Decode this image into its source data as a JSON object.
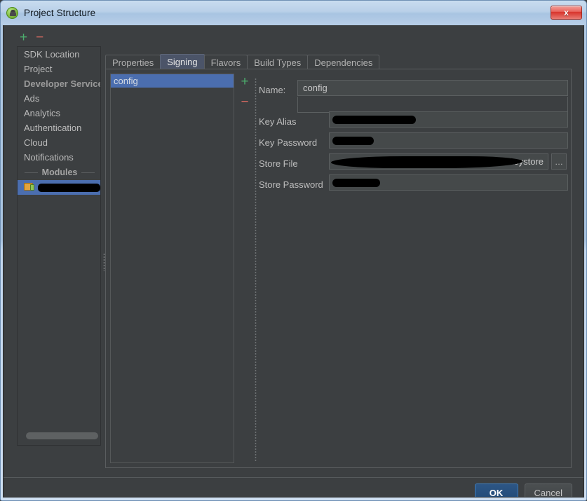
{
  "window": {
    "title": "Project Structure",
    "app_icon": "android-studio-icon",
    "close_label": "x"
  },
  "sidebar": {
    "toolbar": {
      "add_label": "+",
      "remove_label": "−"
    },
    "items": [
      {
        "label": "SDK Location",
        "type": "item"
      },
      {
        "label": "Project",
        "type": "item"
      },
      {
        "label": "Developer Services",
        "type": "header"
      },
      {
        "label": "Ads",
        "type": "item"
      },
      {
        "label": "Analytics",
        "type": "item"
      },
      {
        "label": "Authentication",
        "type": "item"
      },
      {
        "label": "Cloud",
        "type": "item"
      },
      {
        "label": "Notifications",
        "type": "item"
      }
    ],
    "modules_separator": "Modules",
    "module_item": {
      "label": "",
      "redacted": true,
      "selected": true
    }
  },
  "tabs": [
    {
      "label": "Properties",
      "active": false
    },
    {
      "label": "Signing",
      "active": true
    },
    {
      "label": "Flavors",
      "active": false
    },
    {
      "label": "Build Types",
      "active": false
    },
    {
      "label": "Dependencies",
      "active": false
    }
  ],
  "signing": {
    "config_list": {
      "add_label": "+",
      "remove_label": "−",
      "items": [
        {
          "label": "config",
          "selected": true
        }
      ]
    },
    "form": {
      "name_label": "Name:",
      "name_value": "config",
      "key_alias_label": "Key Alias",
      "key_alias_value": "",
      "key_password_label": "Key Password",
      "key_password_value": "",
      "store_file_label": "Store File",
      "store_file_value": ".keystore",
      "store_password_label": "Store Password",
      "store_password_value": "",
      "browse_label": "…"
    }
  },
  "footer": {
    "ok_label": "OK",
    "cancel_label": "Cancel"
  },
  "colors": {
    "background": "#3c3f41",
    "selection": "#4b6eaf",
    "accent_add": "#4caf6d",
    "accent_remove": "#d2685f",
    "default_button": "#2d5685",
    "titlebar": "#b3cce6"
  }
}
